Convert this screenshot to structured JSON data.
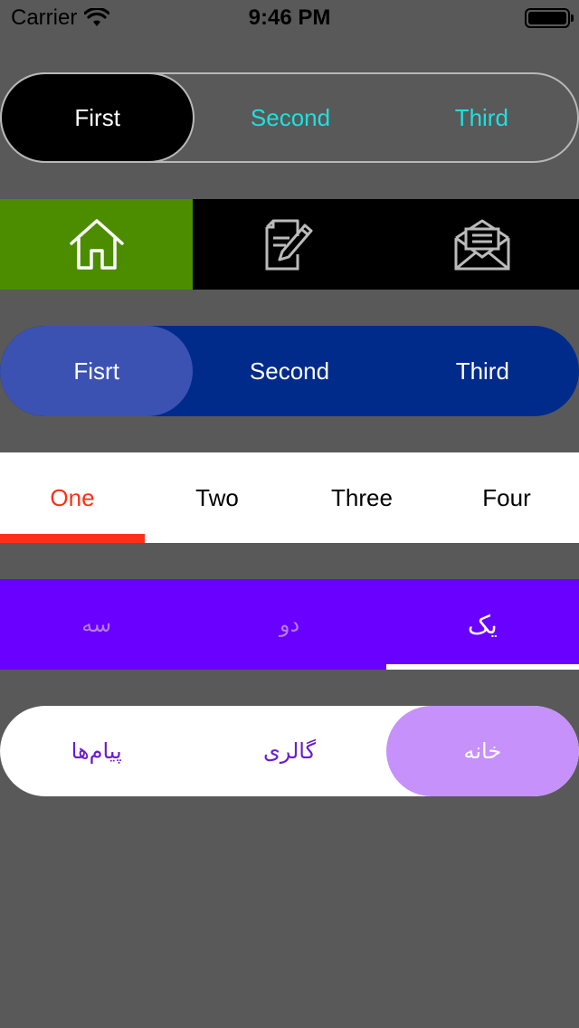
{
  "status_bar": {
    "carrier": "Carrier",
    "time": "9:46 PM"
  },
  "control1": {
    "items": [
      "First",
      "Second",
      "Third"
    ],
    "selected_index": 0,
    "colors": {
      "selected_bg": "#000000",
      "text": "#1fe0e0",
      "selected_text": "#ffffff",
      "border": "#b8b8b8"
    }
  },
  "control2": {
    "icons": [
      "home-icon",
      "edit-document-icon",
      "mail-icon"
    ],
    "selected_index": 0,
    "colors": {
      "selected_bg": "#4c8d00",
      "bg": "#000000"
    }
  },
  "control3": {
    "items": [
      "Fisrt",
      "Second",
      "Third"
    ],
    "selected_index": 0,
    "colors": {
      "bg": "#002b8a",
      "selected_bg": "#3b52b3"
    }
  },
  "control4": {
    "items": [
      "One",
      "Two",
      "Three",
      "Four"
    ],
    "selected_index": 0,
    "colors": {
      "accent": "#ff3015",
      "bg": "#ffffff"
    }
  },
  "control5": {
    "items": [
      "یک",
      "دو",
      "سه"
    ],
    "selected_index": 0,
    "colors": {
      "bg": "#6a00ff",
      "text": "#b57be8",
      "selected_text": "#ffffff"
    }
  },
  "control6": {
    "items": [
      "خانه",
      "گالری",
      "پیام‌ها"
    ],
    "selected_index": 0,
    "colors": {
      "bg": "#ffffff",
      "selected_bg": "#c691fa",
      "text": "#6a1bd1"
    }
  }
}
